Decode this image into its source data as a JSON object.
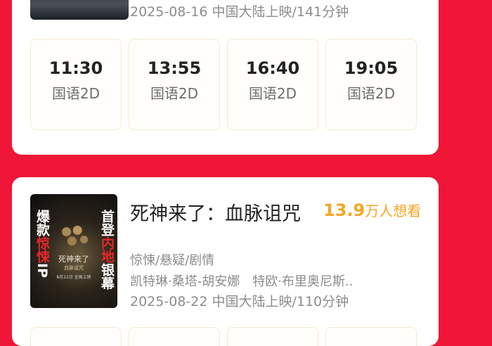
{
  "movie1": {
    "release": "2025-08-16 中国大陆上映/141分钟",
    "showtimes": [
      {
        "time": "11:30",
        "format": "国语2D"
      },
      {
        "time": "13:55",
        "format": "国语2D"
      },
      {
        "time": "16:40",
        "format": "国语2D"
      },
      {
        "time": "19:05",
        "format": "国语2D"
      }
    ]
  },
  "movie2": {
    "title": "死神来了：血脉诅咒",
    "want_count": "13.9",
    "want_unit": "万人想看",
    "genre": "惊悚/悬疑/剧情",
    "cast": "凯特琳·桑塔-胡安娜　特欧·布里奥尼斯..",
    "release": "2025-08-22 中国大陆上映/110分钟",
    "poster": {
      "left_top": "爆款",
      "left_red": "惊悚",
      "left_bottom": "IP",
      "right_top": "首登",
      "right_red": "内地",
      "right_bottom": "银幕",
      "title": "死神来了",
      "subtitle": "血脉诅咒",
      "date": "8月22日 全国上映"
    }
  },
  "colors": {
    "background": "#f01638",
    "accent_orange": "#f5a623",
    "card": "#ffffff"
  }
}
